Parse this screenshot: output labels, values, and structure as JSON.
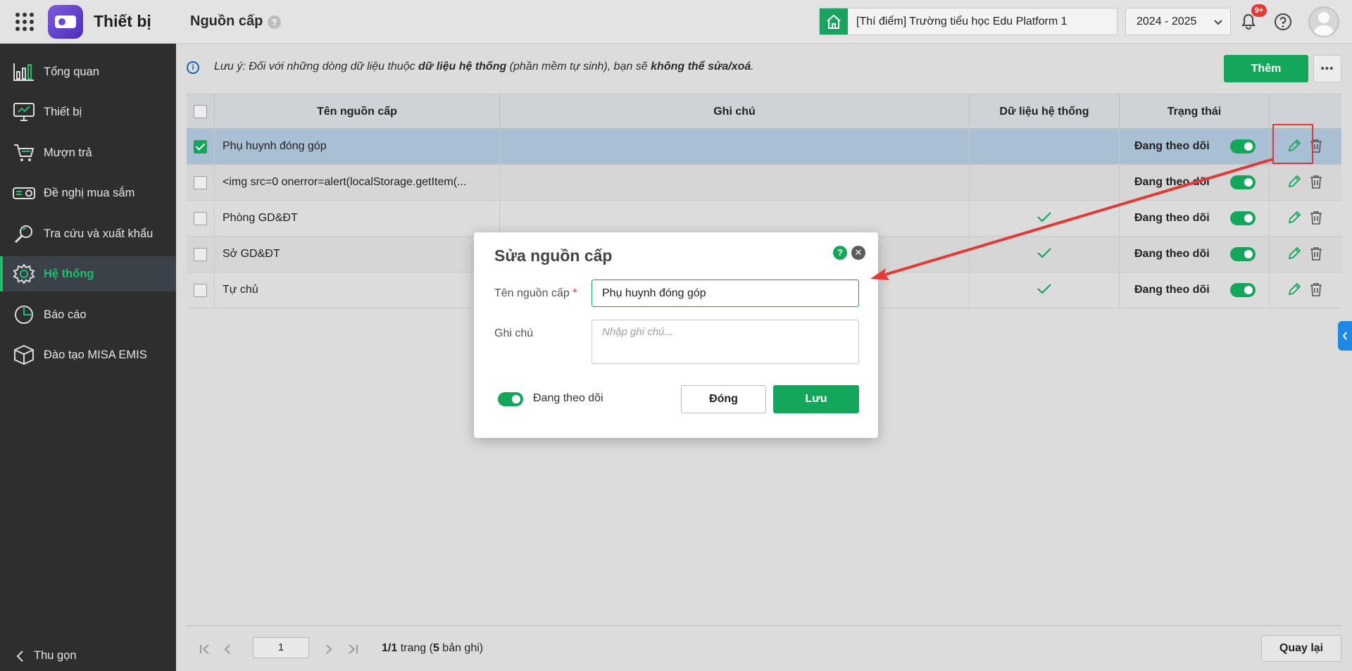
{
  "app": {
    "name": "Thiết bị",
    "page_title": "Nguồn cấp",
    "page_help": "?"
  },
  "header": {
    "school": "[Thí điểm] Trường tiểu học Edu Platform 1",
    "year": "2024 - 2025",
    "notification_count": "9+"
  },
  "sidebar": {
    "items": [
      {
        "label": "Tổng quan",
        "icon": "chart-bars-icon"
      },
      {
        "label": "Thiết bị",
        "icon": "monitor-icon"
      },
      {
        "label": "Mượn trả",
        "icon": "cart-icon"
      },
      {
        "label": "Đề nghị mua sắm",
        "icon": "projector-icon"
      },
      {
        "label": "Tra cứu và xuất khẩu",
        "icon": "search-icon"
      },
      {
        "label": "Hệ thống",
        "icon": "gear-icon"
      },
      {
        "label": "Báo cáo",
        "icon": "pie-chart-icon"
      },
      {
        "label": "Đào tạo MISA EMIS",
        "icon": "cube-icon"
      }
    ],
    "active": "Hệ thống",
    "collapse_label": "Thu gọn"
  },
  "notice": {
    "prefix": "Lưu ý: Đối với những dòng dữ liệu thuộc ",
    "strong1": "dữ liệu hệ thống",
    "middle": " (phần mềm tự sinh), bạn sẽ ",
    "strong2": "không thể sửa/xoá",
    "suffix": "."
  },
  "toolbar": {
    "add_label": "Thêm",
    "more_label": "•••"
  },
  "table": {
    "columns": [
      "Tên nguồn cấp",
      "Ghi chú",
      "Dữ liệu hệ thống",
      "Trạng thái"
    ],
    "rows": [
      {
        "name": "Phụ huynh đóng góp",
        "note": "",
        "system": false,
        "status": "Đang theo dõi",
        "checked": true
      },
      {
        "name": "<img src=0 onerror=alert(localStorage.getItem(...",
        "note": "",
        "system": false,
        "status": "Đang theo dõi",
        "checked": false
      },
      {
        "name": "Phòng GD&ĐT",
        "note": "",
        "system": true,
        "status": "Đang theo dõi",
        "checked": false
      },
      {
        "name": "Sở GD&ĐT",
        "note": "",
        "system": true,
        "status": "Đang theo dõi",
        "checked": false
      },
      {
        "name": "Tự chủ",
        "note": "",
        "system": true,
        "status": "Đang theo dõi",
        "checked": false
      }
    ]
  },
  "pagination": {
    "page": "1",
    "info_pages": "1/1",
    "info_trang": " trang (",
    "info_count": "5",
    "info_tail": " bản ghi)",
    "back_label": "Quay lại"
  },
  "modal": {
    "title": "Sửa nguồn cấp",
    "help": "?",
    "close": "✕",
    "name_label": "Tên nguồn cấp",
    "required_mark": "*",
    "name_value": "Phụ huynh đóng góp",
    "note_label": "Ghi chú",
    "note_placeholder": "Nhập ghi chú...",
    "toggle_label": "Đang theo dõi",
    "close_button": "Đóng",
    "save_button": "Lưu"
  },
  "colors": {
    "accent": "#14a65a",
    "sidebar_bg": "#2e2e2e",
    "annotation": "#e53935"
  }
}
